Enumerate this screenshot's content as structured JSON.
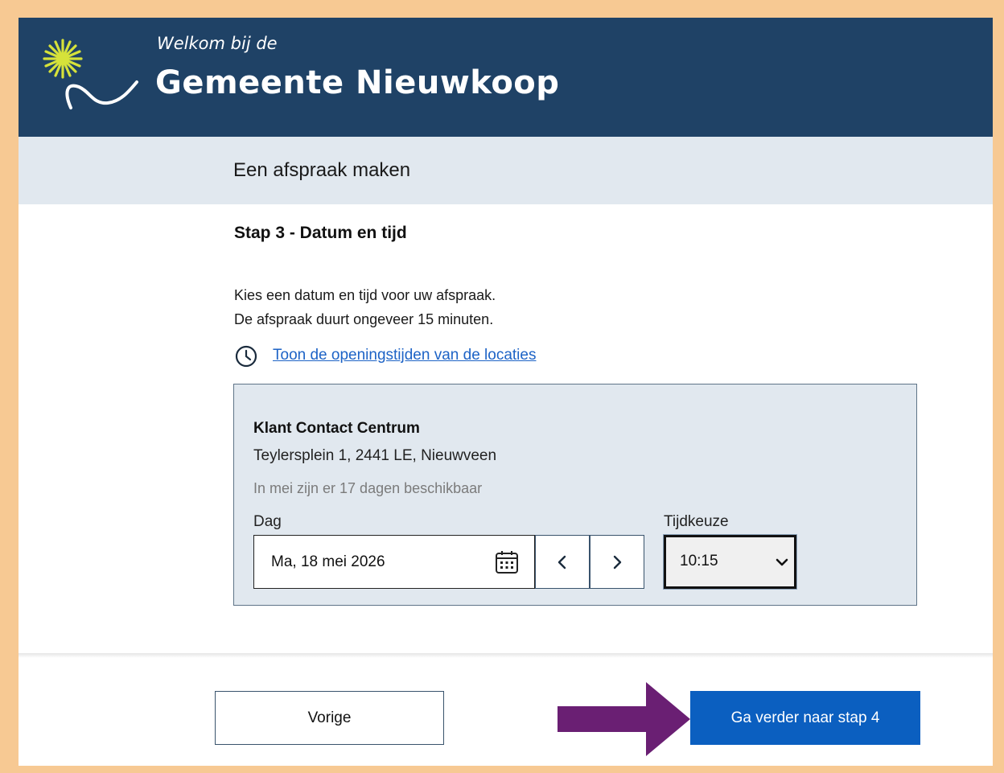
{
  "header": {
    "welcome": "Welkom bij de",
    "title": "Gemeente Nieuwkoop",
    "logo_icon": "sun-flower-logo-icon",
    "colors": {
      "background": "#1f4266",
      "logo_flower": "#d6e23a"
    }
  },
  "band": {
    "title": "Een afspraak maken"
  },
  "step": {
    "title": "Stap 3 - Datum en tijd"
  },
  "intro": {
    "line1": "Kies een datum en tijd voor uw afspraak.",
    "line2": "De afspraak duurt ongeveer 15 minuten."
  },
  "hours_link": {
    "icon": "clock-icon",
    "label": "Toon de openingstijden van de locaties"
  },
  "location": {
    "name": "Klant Contact Centrum",
    "address": "Teylersplein 1, 2441 LE, Nieuwveen",
    "availability": "In mei zijn er 17 dagen beschikbaar",
    "day_label": "Dag",
    "date_value": "Ma, 18 mei 2026",
    "calendar_icon": "calendar-icon",
    "prev_icon": "chevron-left-icon",
    "next_icon": "chevron-right-icon",
    "time_label": "Tijdkeuze",
    "time_value": "10:15"
  },
  "footer": {
    "back_label": "Vorige",
    "next_label": "Ga verder naar stap 4",
    "primary_color": "#0b5fc0",
    "annotation_arrow_color": "#6a1f73"
  }
}
